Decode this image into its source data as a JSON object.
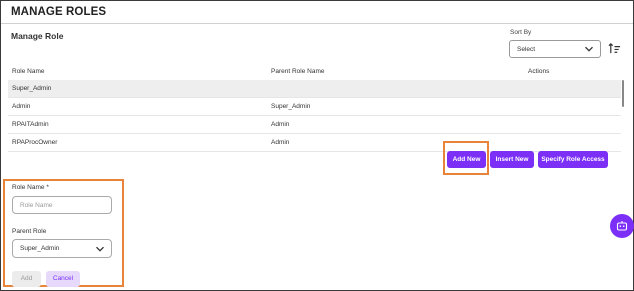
{
  "header": {
    "title": "MANAGE ROLES"
  },
  "section": {
    "title": "Manage Role"
  },
  "sort": {
    "label": "Sort By",
    "value": "Select",
    "icon": "sort-icon"
  },
  "table": {
    "columns": [
      "Role Name",
      "Parent Role Name",
      "Actions"
    ],
    "rows": [
      {
        "role": "Super_Admin",
        "parent": "",
        "selected": true
      },
      {
        "role": "Admin",
        "parent": "Super_Admin"
      },
      {
        "role": "RPAITAdmin",
        "parent": "Admin"
      },
      {
        "role": "RPAProcOwner",
        "parent": "Admin"
      }
    ]
  },
  "actions": {
    "add_new": "Add New",
    "insert_new": "Insert New",
    "specify_access": "Specify Role Access"
  },
  "form": {
    "role_name_label": "Role Name *",
    "role_name_placeholder": "Role Name",
    "parent_role_label": "Parent Role",
    "parent_role_value": "Super_Admin",
    "add_label": "Add",
    "cancel_label": "Cancel"
  },
  "fab": {
    "icon": "chatbot-icon"
  },
  "colors": {
    "accent": "#7b2ff7",
    "highlight": "#e8833a"
  }
}
